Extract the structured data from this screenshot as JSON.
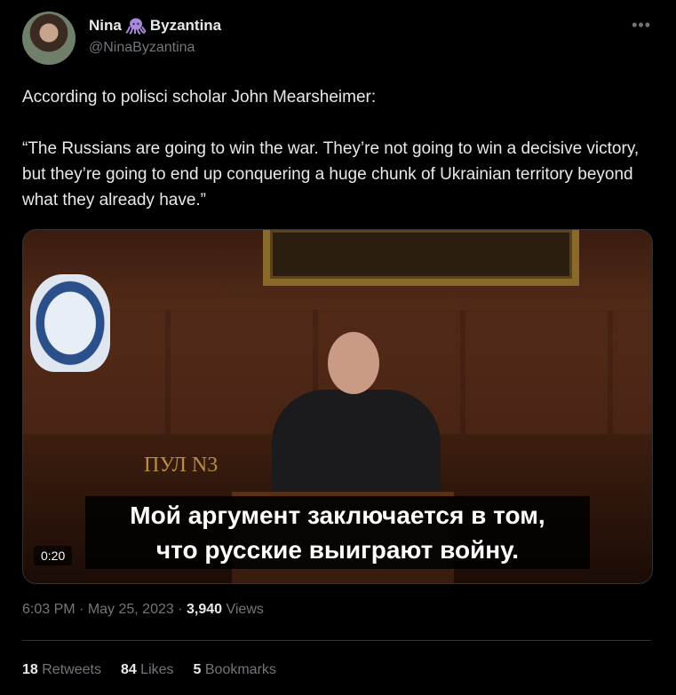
{
  "author": {
    "name_part1": "Nina",
    "emoji_icon": "octopus-icon",
    "name_part2": "Byzantina",
    "handle": "@NinaByzantina"
  },
  "tweet": {
    "line1": "According to polisci scholar John Mearsheimer:",
    "quote": "“The Russians are going to win the war. They’re not going to win a decisive victory, but they’re going to end up conquering a huge chunk of Ukrainian territory beyond what they already have.”"
  },
  "media": {
    "watermark": "ПУЛ N3",
    "subtitle_line1": "Мой аргумент заключается в том,",
    "subtitle_line2": "что русские выиграют войну.",
    "duration": "0:20"
  },
  "meta": {
    "time": "6:03 PM",
    "sep1": " · ",
    "date": "May 25, 2023",
    "sep2": " · ",
    "views_count": "3,940",
    "views_label": " Views"
  },
  "stats": {
    "retweets_count": "18",
    "retweets_label": " Retweets",
    "likes_count": "84",
    "likes_label": " Likes",
    "bookmarks_count": "5",
    "bookmarks_label": " Bookmarks"
  },
  "colors": {
    "background": "#000000",
    "text": "#e7e9ea",
    "secondary": "#71767b",
    "divider": "#2f3336"
  }
}
